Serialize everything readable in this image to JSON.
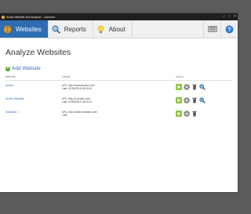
{
  "window": {
    "title": "Acralo Website and Analyzer - Licensed"
  },
  "tabs": [
    {
      "label": "Websites",
      "icon": "globe-icon",
      "active": true
    },
    {
      "label": "Reports",
      "icon": "magnifier-icon",
      "active": false
    },
    {
      "label": "About",
      "icon": "lightbulb-icon",
      "active": false
    }
  ],
  "page": {
    "title": "Analyze Websites",
    "add_label": "Add Website"
  },
  "table": {
    "headers": {
      "website": "Website",
      "details": "Details",
      "action": "Action"
    },
    "rows": [
      {
        "site": "Acralo",
        "url": "URL: http://www.acralo.com/",
        "last": "Last: 01/28/2016 18:43:14"
      },
      {
        "site": "Acralo Website",
        "url": "URL: http://x.acralo.com/",
        "last": "Last: 01/28/2016 18:43:11"
      },
      {
        "site": "Example 1",
        "url": "URL: http://www.example.com/",
        "last": "Last:"
      }
    ]
  },
  "colors": {
    "accent": "#2f6db3",
    "titlebar": "#1f1f1f",
    "backdrop": "#5b5b5b"
  }
}
